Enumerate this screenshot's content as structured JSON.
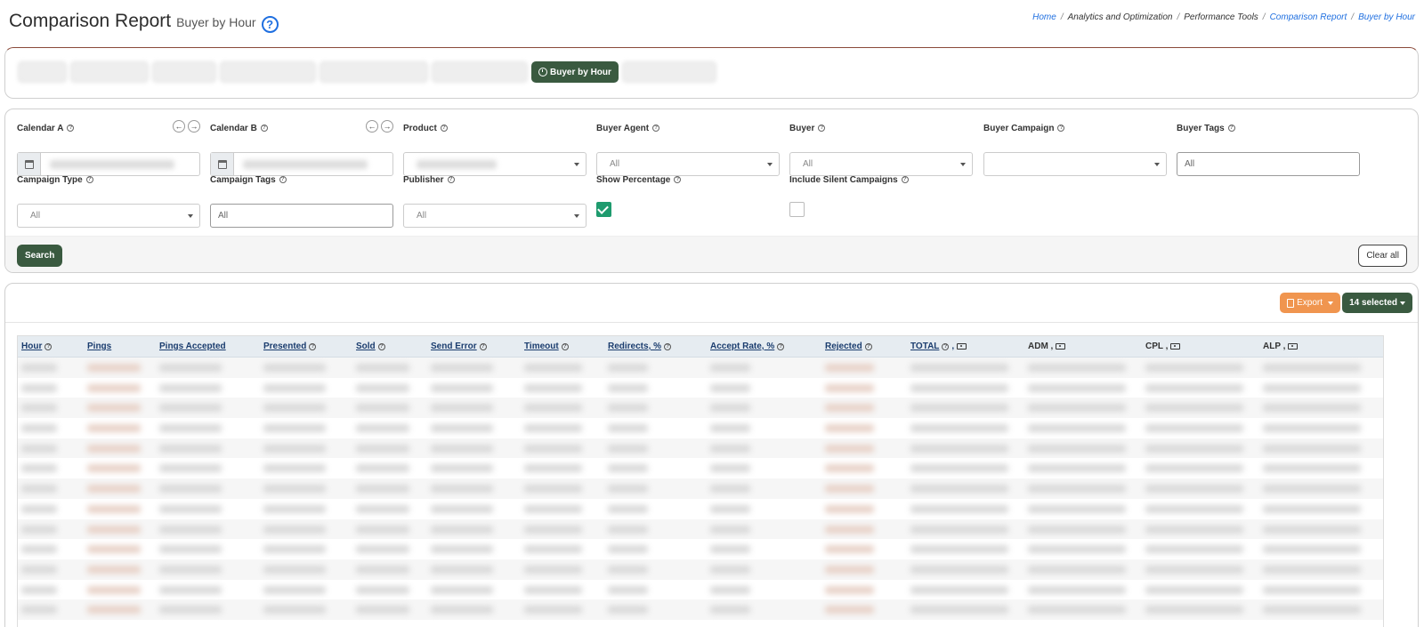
{
  "header": {
    "title": "Comparison Report",
    "subtitle": "Buyer by Hour",
    "help": "?"
  },
  "breadcrumb": [
    {
      "label": "Home",
      "link": true
    },
    {
      "label": "Analytics and Optimization",
      "link": false
    },
    {
      "label": "Performance Tools",
      "link": false
    },
    {
      "label": "Comparison Report",
      "link": true
    },
    {
      "label": "Buyer by Hour",
      "link": true
    }
  ],
  "breadcrumb_sep": "/",
  "tabs": {
    "active_label": "Buyer by Hour"
  },
  "filters": {
    "calendar_a": {
      "label": "Calendar A"
    },
    "calendar_b": {
      "label": "Calendar B"
    },
    "product": {
      "label": "Product"
    },
    "buyer_agent": {
      "label": "Buyer Agent",
      "value": "All"
    },
    "buyer": {
      "label": "Buyer",
      "value": "All"
    },
    "buyer_campaign": {
      "label": "Buyer Campaign",
      "value": ""
    },
    "buyer_tags": {
      "label": "Buyer Tags",
      "value": "All"
    },
    "campaign_type": {
      "label": "Campaign Type",
      "value": "All"
    },
    "campaign_tags": {
      "label": "Campaign Tags",
      "value": "All"
    },
    "publisher": {
      "label": "Publisher",
      "value": "All"
    },
    "show_percentage": {
      "label": "Show Percentage",
      "checked": true
    },
    "include_silent": {
      "label": "Include Silent Campaigns",
      "checked": false
    },
    "prev_arrow": "←",
    "next_arrow": "→",
    "search_label": "Search",
    "clear_label": "Clear all",
    "help": "?"
  },
  "table": {
    "export_label": "Export",
    "selected_label": "14 selected",
    "columns": [
      {
        "label": "Hour"
      },
      {
        "label": "Pings"
      },
      {
        "label": "Pings Accepted"
      },
      {
        "label": "Presented"
      },
      {
        "label": "Sold"
      },
      {
        "label": "Send Error"
      },
      {
        "label": "Timeout"
      },
      {
        "label": "Redirects, %"
      },
      {
        "label": "Accept Rate, %"
      },
      {
        "label": "Rejected"
      },
      {
        "label": "TOTAL"
      },
      {
        "label": "ADM ,"
      },
      {
        "label": "CPL ,"
      },
      {
        "label": "ALP ,"
      }
    ],
    "total_comma": ","
  }
}
